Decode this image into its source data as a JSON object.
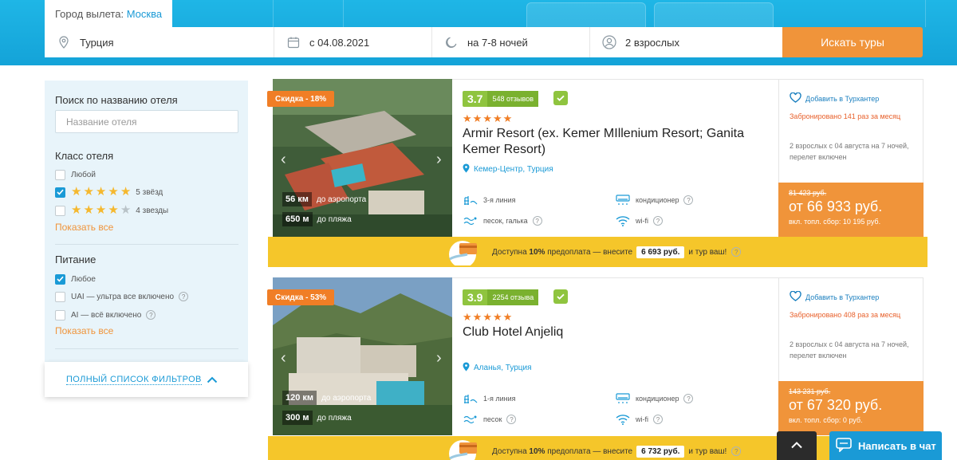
{
  "header": {
    "city_label": "Город вылета:",
    "city_value": "Москва",
    "destination": "Турция",
    "date": "с 04.08.2021",
    "nights": "на 7-8 ночей",
    "tourists": "2 взрослых",
    "search_button": "Искать туры"
  },
  "filters": {
    "hotel_search_title": "Поиск по названию отеля",
    "hotel_search_placeholder": "Название отеля",
    "class_title": "Класс отеля",
    "class_options": [
      {
        "label": "Любой",
        "checked": false
      },
      {
        "label": "5 звёзд",
        "stars": 5,
        "checked": true
      },
      {
        "label": "4 звезды",
        "stars": 4,
        "checked": false
      }
    ],
    "show_all": "Показать все",
    "meal_title": "Питание",
    "meal_options": [
      {
        "label": "Любое",
        "checked": true
      },
      {
        "label": "UAI — ультра все включено",
        "checked": false
      },
      {
        "label": "AI — всё включено",
        "checked": false
      }
    ],
    "show_all_2": "Показать все",
    "full_list": "ПОЛНЫЙ СПИСОК ФИЛЬТРОВ"
  },
  "hotels": [
    {
      "discount": "Скидка - 18%",
      "airport_km": "56 км",
      "airport_label": "до аэропорта",
      "beach_m": "650 м",
      "beach_label": "до пляжа",
      "rating": "3.7",
      "reviews": "548 отзывов",
      "stars": 5,
      "name": "Armir Resort (ex. Kemer MIllenium Resort; Ganita Kemer Resort)",
      "location": "Кемер-Центр, Турция",
      "line": "3-я линия",
      "beach_type": "песок, галька",
      "ac": "кондиционер",
      "wifi": "wi-fi",
      "favorite": "Добавить в Турхантер",
      "booked": "Забронировано 141 раз за месяц",
      "tour_info": "2 взрослых с 04 августа на 7 ночей, перелет включен",
      "old_price": "81 423 руб.",
      "price": "от 66 933 руб.",
      "price_note": "вкл. топл. сбор: 10 195 руб.",
      "prepay_prefix": "Доступна",
      "prepay_percent": "10%",
      "prepay_mid": "предоплата — внесите",
      "prepay_amount": "6 693 руб.",
      "prepay_suffix": "и тур ваш!"
    },
    {
      "discount": "Скидка - 53%",
      "airport_km": "120 км",
      "airport_label": "до аэропорта",
      "beach_m": "300 м",
      "beach_label": "до пляжа",
      "rating": "3.9",
      "reviews": "2254 отзыва",
      "stars": 5,
      "name": "Club Hotel Anjeliq",
      "location": "Аланья, Турция",
      "line": "1-я линия",
      "beach_type": "песок",
      "ac": "кондиционер",
      "wifi": "wi-fi",
      "favorite": "Добавить в Турхантер",
      "booked": "Забронировано 408 раз за месяц",
      "tour_info": "2 взрослых с 04 августа на 7 ночей, перелет включен",
      "old_price": "143 231 руб.",
      "price": "от 67 320 руб.",
      "price_note": "вкл. топл. сбор: 0 руб.",
      "prepay_prefix": "Доступна",
      "prepay_percent": "10%",
      "prepay_mid": "предоплата — внесите",
      "prepay_amount": "6 732 руб.",
      "prepay_suffix": "и тур ваш!"
    }
  ],
  "chat": {
    "label": "Написать в чат"
  },
  "colors": {
    "accent": "#1a9ad6",
    "orange": "#f0943a",
    "header": "#1fb6e6",
    "yellow": "#f5c62a",
    "green": "#8fc43f"
  }
}
